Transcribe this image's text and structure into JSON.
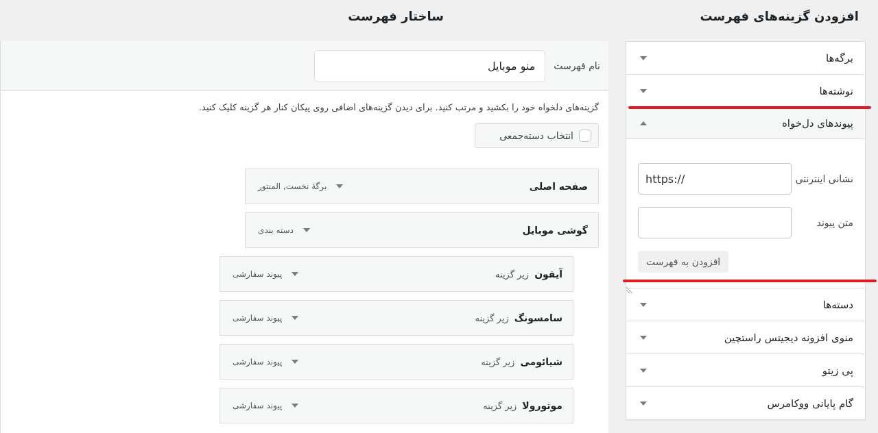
{
  "structure": {
    "heading": "ساختار فهرست",
    "menu_name": {
      "label": "نام فهرست",
      "value": "منو موبایل"
    },
    "instructions": "گزینه‌های دلخواه خود را بکشید و مرتب کنید. برای دیدن گزینه‌های اضافی روی پیکان کنار هر گزینه کلیک کنید.",
    "bulk_select": {
      "label": "انتخاب دسته‌جمعی",
      "checked": false
    },
    "menu_items": [
      {
        "title": "صفحه اصلی",
        "type": "برگهٔ نخست, المنتور",
        "expanded": false
      },
      {
        "title": "گوشی موبایل",
        "type": "دسته بندی",
        "expanded": false,
        "children": [
          {
            "title": "آیفون",
            "sublabel": "زیر گزینه",
            "type": "پیوند سفارشی",
            "expanded": false
          },
          {
            "title": "سامسونگ",
            "sublabel": "زیر گزینه",
            "type": "پیوند سفارشی",
            "expanded": false
          },
          {
            "title": "شیائومی",
            "sublabel": "زیر گزینه",
            "type": "پیوند سفارشی",
            "expanded": false
          },
          {
            "title": "موتورولا",
            "sublabel": "زیر گزینه",
            "type": "پیوند سفارشی",
            "expanded": false
          }
        ]
      }
    ]
  },
  "add_items": {
    "heading": "افزودن گزینه‌های فهرست",
    "sections": [
      {
        "title": "برگه‌ها",
        "expanded": false
      },
      {
        "title": "نوشته‌ها",
        "expanded": false
      },
      {
        "title": "پیوندهای دل‌خواه",
        "expanded": true,
        "form": {
          "url_label": "نشانی اینترنتی",
          "url_value": "https://",
          "text_label": "متن پیوند",
          "button": "افزودن به فهرست"
        }
      },
      {
        "title": "دسته‌ها",
        "expanded": false
      },
      {
        "title": "منوی افزونه دیجیتس راستچین",
        "expanded": false
      },
      {
        "title": "پی زیتو",
        "expanded": false
      },
      {
        "title": "گام پایانی ووکامرس",
        "expanded": false
      }
    ]
  }
}
